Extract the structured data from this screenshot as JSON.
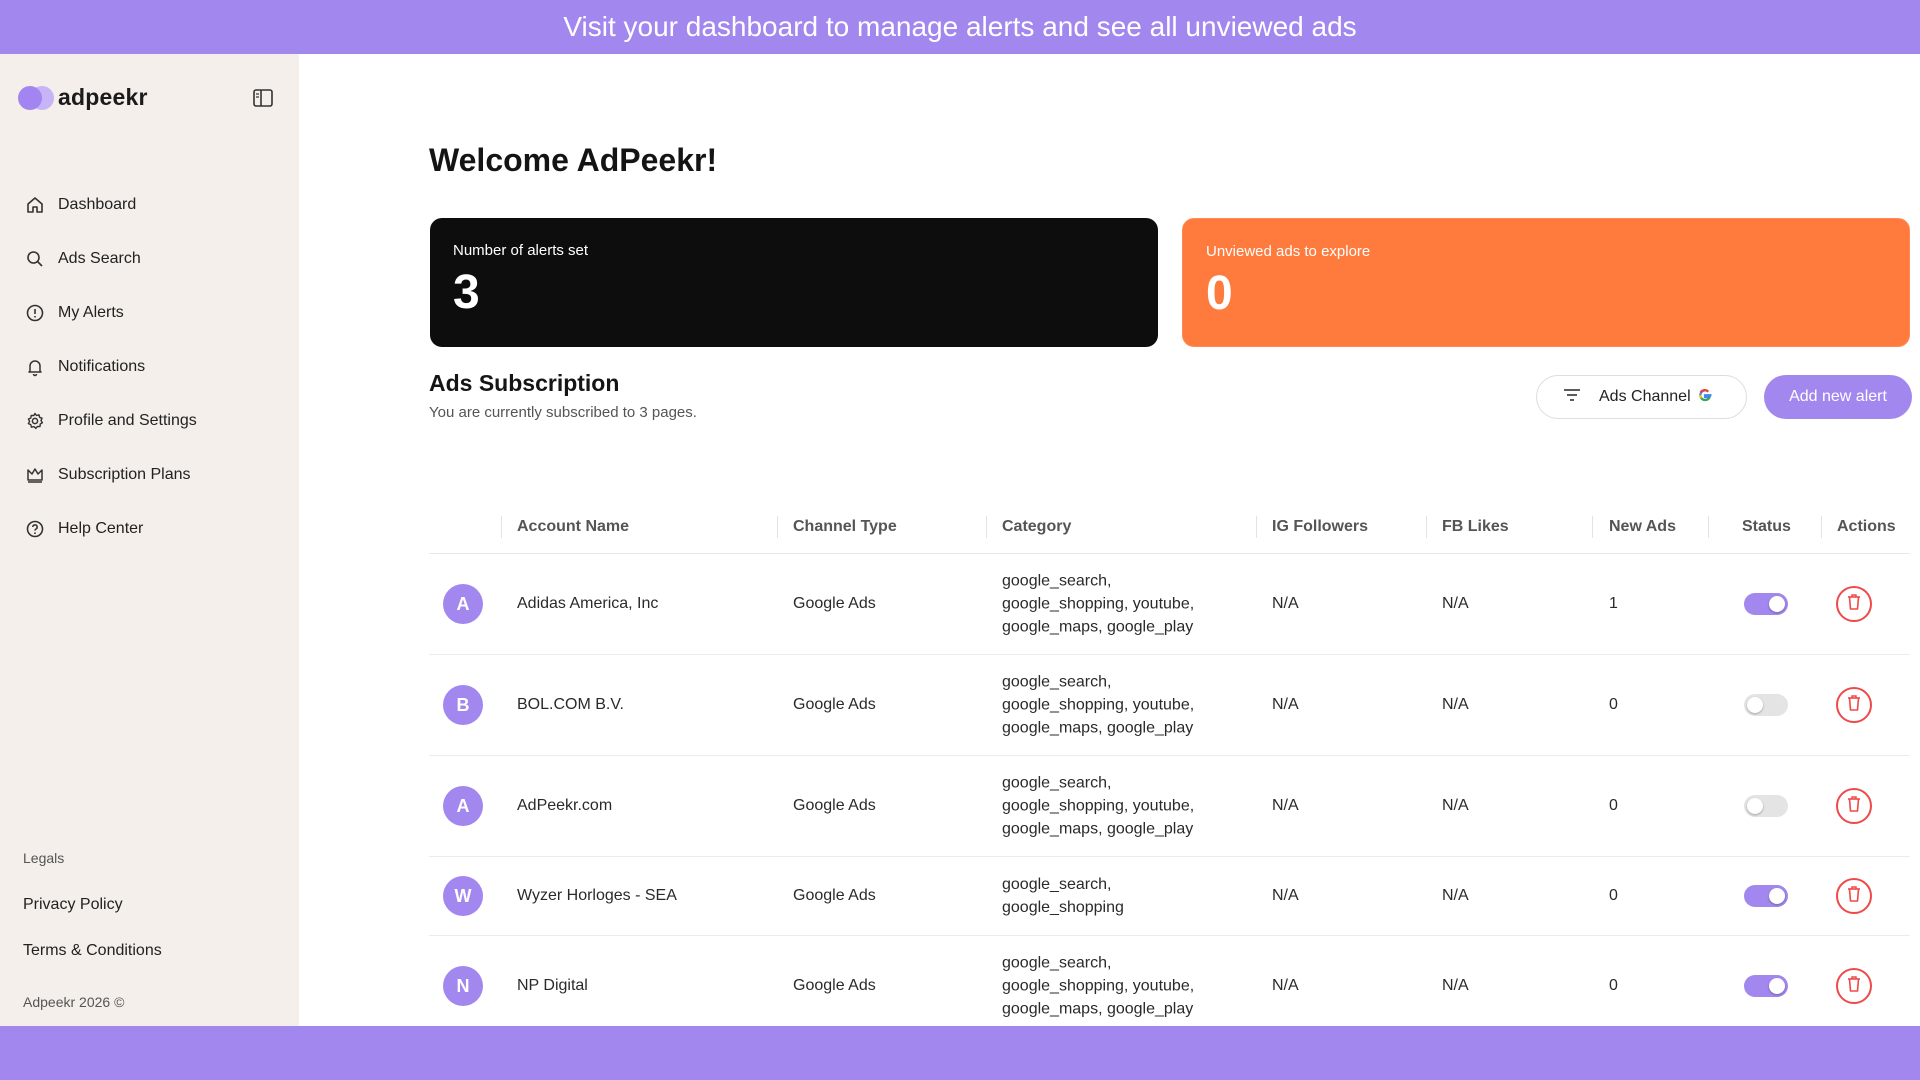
{
  "banner": {
    "text": "Visit your dashboard to manage alerts and see all unviewed ads"
  },
  "brand": {
    "name": "adpeekr"
  },
  "sidebar": {
    "items": [
      {
        "label": "Dashboard",
        "icon": "home-icon"
      },
      {
        "label": "Ads Search",
        "icon": "search-icon"
      },
      {
        "label": "My Alerts",
        "icon": "alert-circle-icon"
      },
      {
        "label": "Notifications",
        "icon": "bell-icon"
      },
      {
        "label": "Profile and Settings",
        "icon": "gear-icon"
      },
      {
        "label": "Subscription Plans",
        "icon": "crown-icon"
      },
      {
        "label": "Help Center",
        "icon": "help-circle-icon"
      }
    ],
    "legals_label": "Legals",
    "privacy_policy": "Privacy Policy",
    "terms": "Terms & Conditions",
    "copyright": "Adpeekr 2026 ©"
  },
  "main": {
    "welcome": "Welcome AdPeekr!",
    "stats": {
      "alerts_label": "Number of alerts set",
      "alerts_value": "3",
      "unviewed_label": "Unviewed ads to explore",
      "unviewed_value": "0"
    },
    "subscription": {
      "title": "Ads Subscription",
      "description": "You are currently subscribed to 3 pages.",
      "channel_button": "Ads Channel",
      "add_button": "Add new alert"
    },
    "table": {
      "headers": [
        "Account Name",
        "Channel Type",
        "Category",
        "IG Followers",
        "FB Likes",
        "New Ads",
        "Status",
        "Actions"
      ],
      "rows": [
        {
          "initial": "A",
          "account": "Adidas America, Inc",
          "channel": "Google Ads",
          "category": [
            "google_search,",
            "google_shopping, youtube,",
            "google_maps, google_play"
          ],
          "ig": "N/A",
          "fb": "N/A",
          "new_ads": "1",
          "status_on": true
        },
        {
          "initial": "B",
          "account": "BOL.COM B.V.",
          "channel": "Google Ads",
          "category": [
            "google_search,",
            "google_shopping, youtube,",
            "google_maps, google_play"
          ],
          "ig": "N/A",
          "fb": "N/A",
          "new_ads": "0",
          "status_on": false
        },
        {
          "initial": "A",
          "account": "AdPeekr.com",
          "channel": "Google Ads",
          "category": [
            "google_search,",
            "google_shopping, youtube,",
            "google_maps, google_play"
          ],
          "ig": "N/A",
          "fb": "N/A",
          "new_ads": "0",
          "status_on": false
        },
        {
          "initial": "W",
          "account": "Wyzer Horloges - SEA",
          "channel": "Google Ads",
          "category": [
            "google_search,",
            "google_shopping"
          ],
          "ig": "N/A",
          "fb": "N/A",
          "new_ads": "0",
          "status_on": true
        },
        {
          "initial": "N",
          "account": "NP Digital",
          "channel": "Google Ads",
          "category": [
            "google_search,",
            "google_shopping, youtube,",
            "google_maps, google_play"
          ],
          "ig": "N/A",
          "fb": "N/A",
          "new_ads": "0",
          "status_on": true
        }
      ]
    }
  },
  "colors": {
    "accent": "#a287ef",
    "orange": "#ff7a3d",
    "dark": "#0d0d0d",
    "danger": "#ef4a4a"
  }
}
